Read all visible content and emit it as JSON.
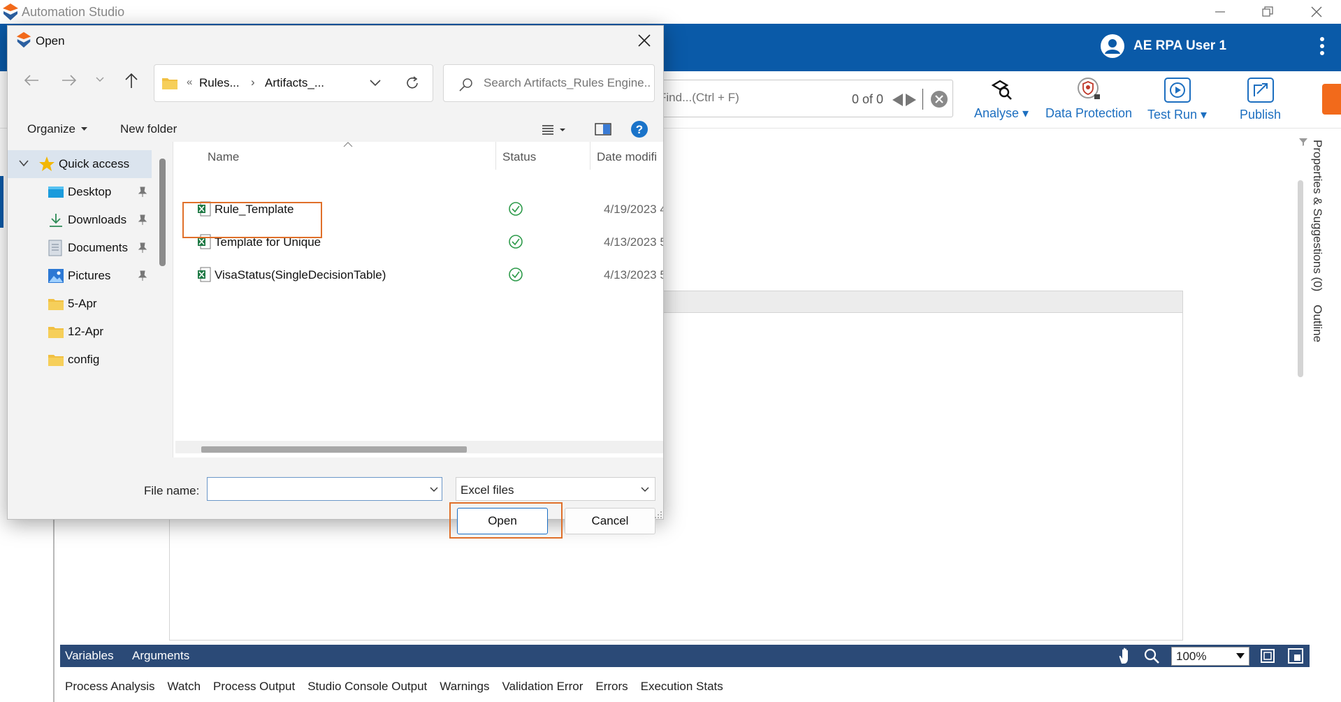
{
  "app": {
    "title": "Automation Studio",
    "user_name": "AE RPA User 1",
    "colors": {
      "brand_blue": "#0a5aa8",
      "accent_orange": "#f26a1b",
      "link_blue": "#1d6fc0",
      "bottom_bar": "#2b4a77"
    }
  },
  "toolbar": {
    "find_placeholder": "Find...(Ctrl + F)",
    "find_count": "0 of 0",
    "buttons": [
      {
        "label": "Analyse",
        "icon": "analyse-icon",
        "has_dropdown": true
      },
      {
        "label": "Data Protection",
        "icon": "shield-lock-icon",
        "has_dropdown": false
      },
      {
        "label": "Test Run",
        "icon": "play-icon",
        "has_dropdown": true
      },
      {
        "label": "Publish",
        "icon": "publish-icon",
        "has_dropdown": false
      }
    ]
  },
  "right_panel": {
    "label": "Properties & Suggestions (0)    Outline"
  },
  "bottom_bar": {
    "tabs": [
      "Variables",
      "Arguments"
    ],
    "zoom": "100%"
  },
  "output_tabs": [
    "Process Analysis",
    "Watch",
    "Process Output",
    "Studio Console Output",
    "Warnings",
    "Validation Error",
    "Errors",
    "Execution Stats"
  ],
  "dialog": {
    "title": "Open",
    "address": {
      "prefix": "«",
      "segment1": "Rules...",
      "separator": "›",
      "segment2": "Artifacts_..."
    },
    "search_placeholder": "Search Artifacts_Rules Engine...",
    "organize_label": "Organize",
    "new_folder_label": "New folder",
    "nav_items": [
      {
        "label": "Quick access",
        "icon": "star-icon",
        "pinned": false
      },
      {
        "label": "Desktop",
        "icon": "desktop-icon",
        "pinned": true
      },
      {
        "label": "Downloads",
        "icon": "download-icon",
        "pinned": true
      },
      {
        "label": "Documents",
        "icon": "document-icon",
        "pinned": true
      },
      {
        "label": "Pictures",
        "icon": "picture-icon",
        "pinned": true
      },
      {
        "label": "5-Apr",
        "icon": "folder-icon",
        "pinned": false
      },
      {
        "label": "12-Apr",
        "icon": "folder-icon",
        "pinned": false
      },
      {
        "label": "config",
        "icon": "folder-icon",
        "pinned": false
      }
    ],
    "columns": {
      "name": "Name",
      "status": "Status",
      "date": "Date modifi"
    },
    "files": [
      {
        "name": "Rule_Template",
        "date": "4/19/2023 4",
        "status": "synced"
      },
      {
        "name": "Template for Unique",
        "date": "4/13/2023 5",
        "status": "synced"
      },
      {
        "name": "VisaStatus(SingleDecisionTable)",
        "date": "4/13/2023 5",
        "status": "synced"
      }
    ],
    "file_name_label": "File name:",
    "file_name_value": "",
    "file_type": "Excel files",
    "open_label": "Open",
    "cancel_label": "Cancel"
  }
}
